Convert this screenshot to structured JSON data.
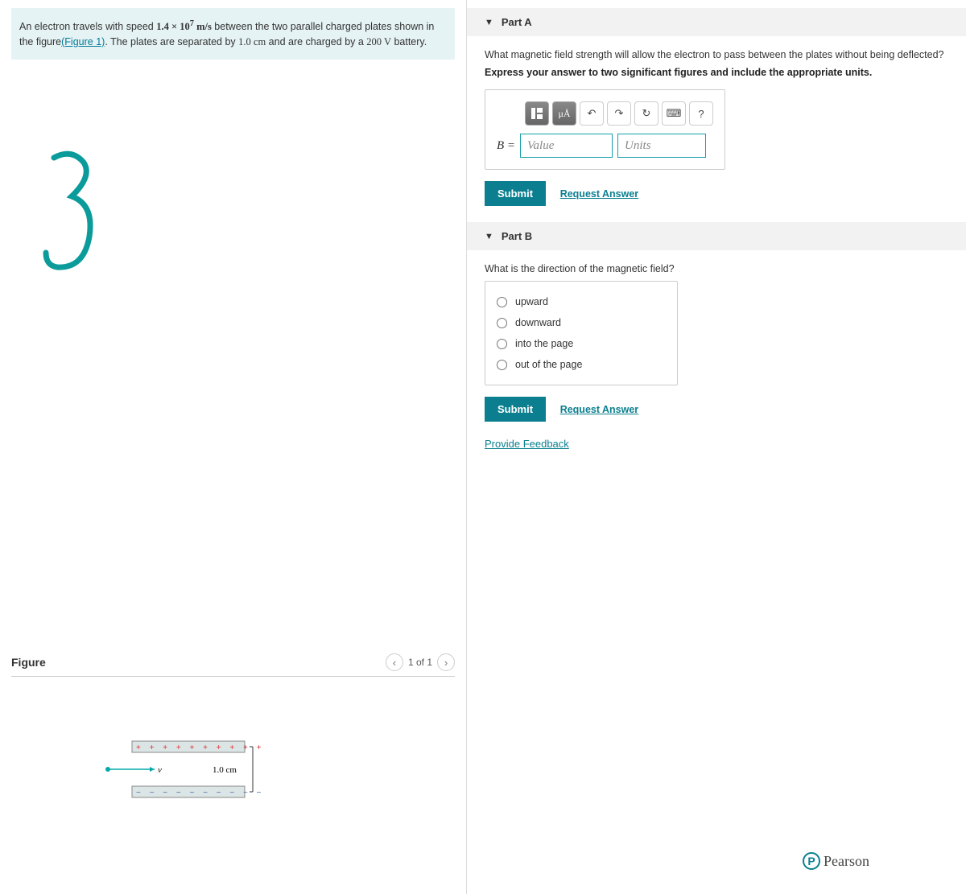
{
  "problem": {
    "text_prefix": "An electron travels with speed ",
    "speed": "1.4 × 10",
    "speed_exp": "7",
    "speed_units": " m/s",
    "text_mid1": " between the two parallel charged plates shown in the figure",
    "figure_link": "(Figure 1)",
    "text_mid2": ". The plates are separated by ",
    "separation": "1.0 cm",
    "text_mid3": " and are charged by a ",
    "voltage": "200 V",
    "text_end": " battery."
  },
  "figure": {
    "title": "Figure",
    "page_label": "1 of 1",
    "distance_label": "1.0 cm",
    "v_label": "v⃗"
  },
  "partA": {
    "header": "Part A",
    "question": "What magnetic field strength will allow the electron to pass between the plates without being deflected?",
    "instruct": "Express your answer to two significant figures and include the appropriate units.",
    "var_label": "B = ",
    "value_placeholder": "Value",
    "units_placeholder": "Units",
    "submit": "Submit",
    "request": "Request Answer",
    "toolbar": {
      "templates": "▫▪",
      "greek": "μÅ",
      "undo": "↶",
      "redo": "↷",
      "reset": "↻",
      "keyboard": "⌨",
      "help": "?"
    }
  },
  "partB": {
    "header": "Part B",
    "question": "What is the direction of the magnetic field?",
    "options": [
      "upward",
      "downward",
      "into the page",
      "out of the page"
    ],
    "submit": "Submit",
    "request": "Request Answer"
  },
  "feedback_link": "Provide Feedback",
  "brand": "Pearson"
}
